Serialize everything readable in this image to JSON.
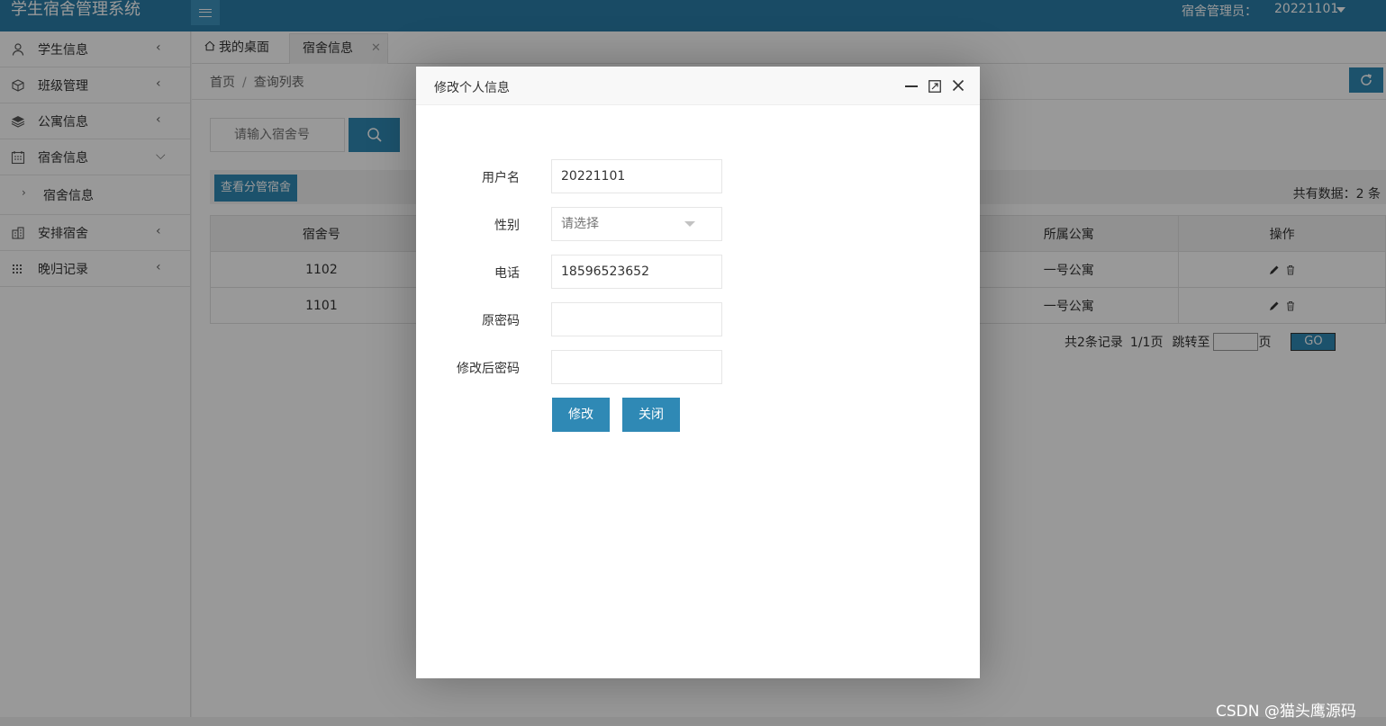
{
  "header": {
    "title": "学生宿舍管理系统",
    "admin_label": "宿舍管理员：",
    "username": "20221101"
  },
  "sidebar": {
    "items": [
      {
        "label": "学生信息",
        "icon": "user-icon"
      },
      {
        "label": "班级管理",
        "icon": "cube-icon"
      },
      {
        "label": "公寓信息",
        "icon": "layers-icon"
      },
      {
        "label": "宿舍信息",
        "icon": "calendar-icon"
      },
      {
        "label": "安排宿舍",
        "icon": "building-icon"
      },
      {
        "label": "晚归记录",
        "icon": "grid-icon"
      }
    ],
    "sub_item": "宿舍信息"
  },
  "tabs": {
    "home": "我的桌面",
    "active": "宿舍信息"
  },
  "breadcrumb": {
    "home": "首页",
    "current": "查询列表"
  },
  "search": {
    "placeholder": "请输入宿舍号"
  },
  "toolbar": {
    "view_button": "查看分管宿舍",
    "total": "共有数据：2 条"
  },
  "table": {
    "headers": [
      "宿舍号",
      "",
      "所属公寓",
      "操作"
    ],
    "rows": [
      {
        "no": "1102",
        "apartment": "一号公寓"
      },
      {
        "no": "1101",
        "apartment": "一号公寓"
      }
    ]
  },
  "pager": {
    "summary": "共2条记录",
    "pages": "1/1页",
    "jump": "跳转至",
    "page_unit": "页",
    "go": "GO"
  },
  "modal": {
    "title": "修改个人信息",
    "fields": {
      "username_label": "用户名",
      "username_value": "20221101",
      "gender_label": "性别",
      "gender_placeholder": "请选择",
      "phone_label": "电话",
      "phone_value": "18596523652",
      "old_password_label": "原密码",
      "new_password_label": "修改后密码"
    },
    "submit": "修改",
    "close": "关闭"
  },
  "watermark": "CSDN @猫头鹰源码"
}
